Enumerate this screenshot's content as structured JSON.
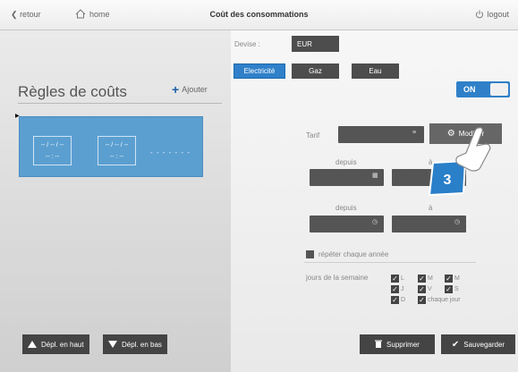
{
  "topbar": {
    "back_label": "retour",
    "home_label": "home",
    "title": "Coût des consommations",
    "logout_label": "logout"
  },
  "left": {
    "heading": "Règles de coûts",
    "add_label": "Ajouter",
    "card": {
      "slot1_date": "-- / -- / --",
      "slot1_time": "-- : --",
      "slot2_date": "-- / -- / --",
      "slot2_time": "-- : --",
      "dots": "- - - - - - -"
    }
  },
  "currency": {
    "label": "Devise :",
    "value": "EUR"
  },
  "energy_tabs": [
    {
      "label": "Electricité",
      "active": true
    },
    {
      "label": "Gaz",
      "active": false
    },
    {
      "label": "Eau",
      "active": false
    }
  ],
  "toggle": {
    "label": "ON"
  },
  "tarif": {
    "label": "Tarif",
    "value": "",
    "modify_label": "Modifier"
  },
  "period": {
    "since_label": "depuis",
    "to_label": "à"
  },
  "repeat": {
    "label": "répéter chaque année",
    "checked": false
  },
  "days": {
    "label": "jours de la semaine",
    "items": [
      {
        "label": "L",
        "checked": true
      },
      {
        "label": "M",
        "checked": true
      },
      {
        "label": "M",
        "checked": true
      },
      {
        "label": "J",
        "checked": true
      },
      {
        "label": "V",
        "checked": true
      },
      {
        "label": "S",
        "checked": true
      },
      {
        "label": "D",
        "checked": true
      },
      {
        "label": "chaque jour",
        "checked": true
      }
    ]
  },
  "bottom": {
    "move_up_label": "Dépl. en haut",
    "move_down_label": "Dépl. en bas",
    "delete_label": "Supprimer",
    "save_label": "Sauvegarder"
  },
  "callout": {
    "number": "3"
  },
  "colors": {
    "accent": "#2f80c9",
    "card": "#5b9fd1",
    "dark": "#4d4d4d"
  }
}
